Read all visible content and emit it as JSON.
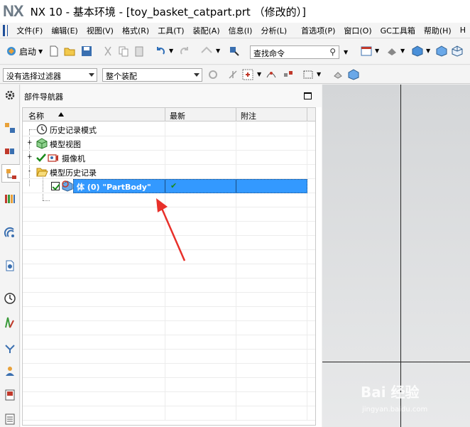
{
  "window": {
    "logo": "NX",
    "title": "NX 10 - 基本环境 - [toy_basket_catpart.prt （修改的）]"
  },
  "menu": {
    "items": [
      "文件(F)",
      "编辑(E)",
      "视图(V)",
      "格式(R)",
      "工具(T)",
      "装配(A)",
      "信息(I)",
      "分析(L)",
      "首选项(P)",
      "窗口(O)",
      "GC工具箱",
      "帮助(H)",
      "H"
    ]
  },
  "toolbar": {
    "start_label": "启动",
    "search_placeholder": "查找命令",
    "filter_value": "没有选择过滤器",
    "scope_value": "整个装配"
  },
  "navigator": {
    "title": "部件导航器",
    "columns": [
      "名称",
      "最新",
      "附注"
    ],
    "rows": [
      {
        "label": "历史记录模式",
        "icon": "clock-icon",
        "expander": ""
      },
      {
        "label": "模型视图",
        "icon": "model-view-icon",
        "expander": "+"
      },
      {
        "label": "摄像机",
        "icon": "camera-icon",
        "expander": "+"
      },
      {
        "label": "模型历史记录",
        "icon": "folder-open-icon",
        "expander": "-"
      },
      {
        "label": "体 (0) \"PartBody\"",
        "icon": "body-icon",
        "expander": "",
        "selected": true,
        "latest": "✔"
      }
    ]
  },
  "watermark": {
    "main": "Bai 经验",
    "sub": "jingyan.baidu.com"
  },
  "colors": {
    "selection": "#3399ff",
    "check_green": "#1a8a1a",
    "arrow_red": "#e8302a"
  }
}
